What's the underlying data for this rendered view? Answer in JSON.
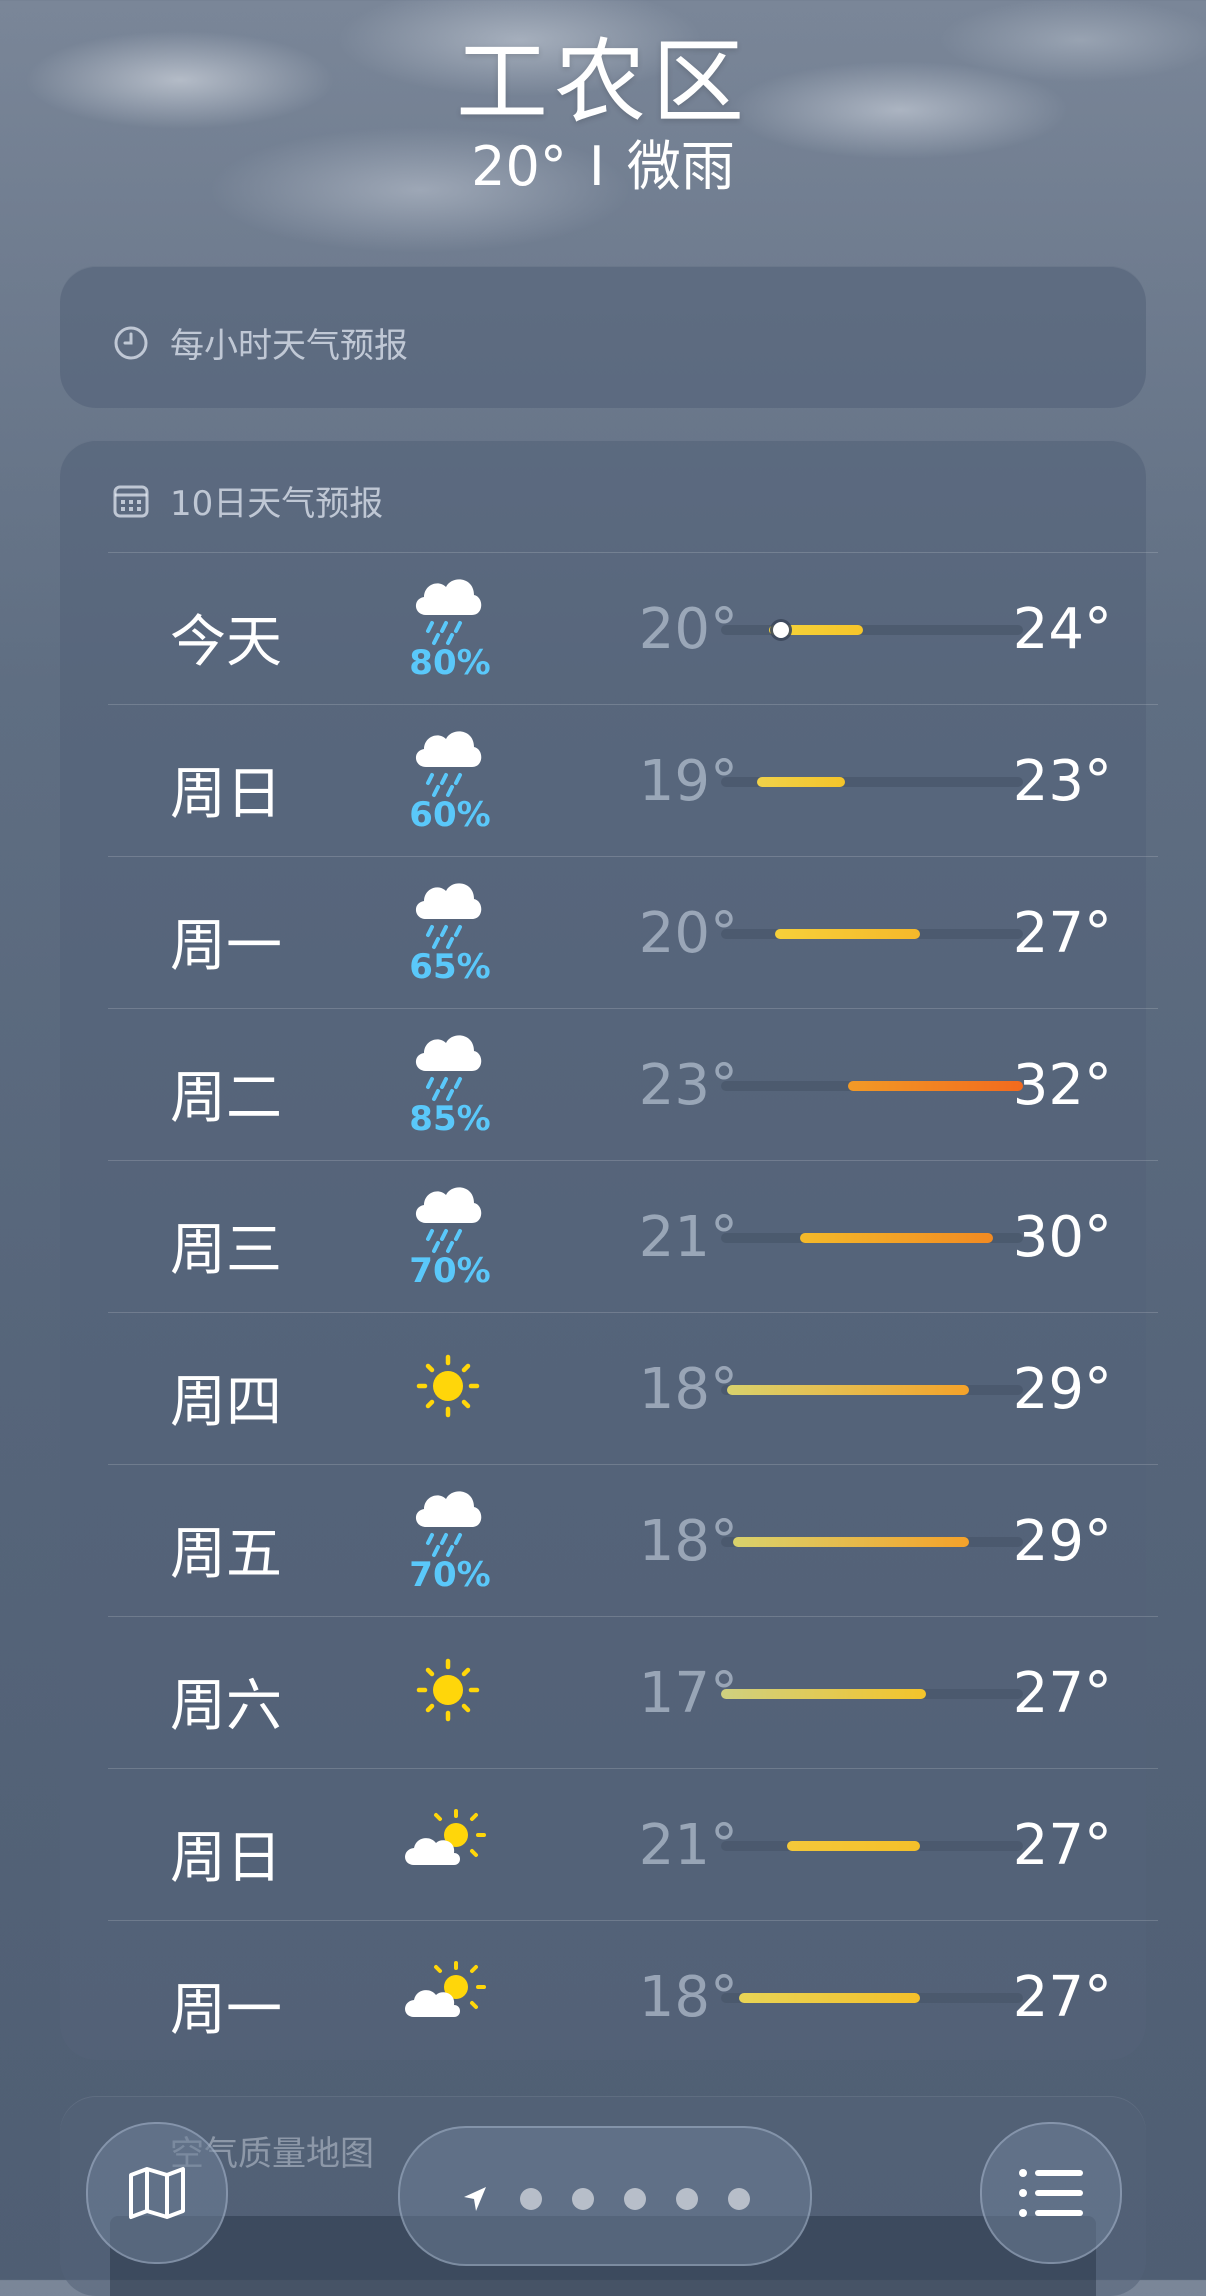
{
  "header": {
    "city": "工农区",
    "temperature": "20°",
    "separator": "I",
    "condition": "微雨"
  },
  "hourly_card": {
    "title": "每小时天气预报",
    "icon": "clock-icon"
  },
  "daily_card": {
    "title": "10日天气预报",
    "icon": "calendar-icon",
    "current_temp_marker": 20,
    "days": [
      {
        "day": "今天",
        "icon": "cloud-rain-icon",
        "precip": "80%",
        "low": "20°",
        "high": "24°",
        "low_value": 20,
        "high_value": 24,
        "bar_from": 0.16,
        "bar_to": 0.47,
        "colors": [
          "#f6d43a",
          "#f6c52a"
        ],
        "show_dot": true,
        "dot_at": 0.2
      },
      {
        "day": "周日",
        "icon": "cloud-rain-icon",
        "precip": "60%",
        "low": "19°",
        "high": "23°",
        "low_value": 19,
        "high_value": 23,
        "bar_from": 0.12,
        "bar_to": 0.41,
        "colors": [
          "#f1d24a",
          "#f4c42a"
        ],
        "show_dot": false
      },
      {
        "day": "周一",
        "icon": "cloud-rain-icon",
        "precip": "65%",
        "low": "20°",
        "high": "27°",
        "low_value": 20,
        "high_value": 27,
        "bar_from": 0.18,
        "bar_to": 0.66,
        "colors": [
          "#f6d03a",
          "#f5b82a"
        ],
        "show_dot": false
      },
      {
        "day": "周二",
        "icon": "cloud-rain-icon",
        "precip": "85%",
        "low": "23°",
        "high": "32°",
        "low_value": 23,
        "high_value": 32,
        "bar_from": 0.42,
        "bar_to": 1.0,
        "colors": [
          "#f29a26",
          "#f26a1e"
        ],
        "show_dot": false
      },
      {
        "day": "周三",
        "icon": "cloud-rain-icon",
        "precip": "70%",
        "low": "21°",
        "high": "30°",
        "low_value": 21,
        "high_value": 30,
        "bar_from": 0.26,
        "bar_to": 0.9,
        "colors": [
          "#f4ba2a",
          "#f28a22"
        ],
        "show_dot": false
      },
      {
        "day": "周四",
        "icon": "sun-icon",
        "precip": "",
        "low": "18°",
        "high": "29°",
        "low_value": 18,
        "high_value": 29,
        "bar_from": 0.02,
        "bar_to": 0.82,
        "colors": [
          "#d9d26c",
          "#f4a22a"
        ],
        "show_dot": false
      },
      {
        "day": "周五",
        "icon": "cloud-rain-icon",
        "precip": "70%",
        "low": "18°",
        "high": "29°",
        "low_value": 18,
        "high_value": 29,
        "bar_from": 0.04,
        "bar_to": 0.82,
        "colors": [
          "#d9d26c",
          "#f4a22a"
        ],
        "show_dot": false
      },
      {
        "day": "周六",
        "icon": "sun-icon",
        "precip": "",
        "low": "17°",
        "high": "27°",
        "low_value": 17,
        "high_value": 27,
        "bar_from": 0.0,
        "bar_to": 0.68,
        "colors": [
          "#cfd080",
          "#f4c42a"
        ],
        "show_dot": false
      },
      {
        "day": "周日",
        "icon": "partly-cloudy-icon",
        "precip": "",
        "low": "21°",
        "high": "27°",
        "low_value": 21,
        "high_value": 27,
        "bar_from": 0.22,
        "bar_to": 0.66,
        "colors": [
          "#f4c83a",
          "#f4c02a"
        ],
        "show_dot": false
      },
      {
        "day": "周一",
        "icon": "partly-cloudy-icon",
        "precip": "",
        "low": "18°",
        "high": "27°",
        "low_value": 18,
        "high_value": 27,
        "bar_from": 0.06,
        "bar_to": 0.66,
        "colors": [
          "#e9d556",
          "#f4c02a"
        ],
        "show_dot": false
      }
    ]
  },
  "aqi_card": {
    "title": "空气质量地图"
  },
  "bottom_bar": {
    "map_button": "map-icon",
    "list_button": "list-icon",
    "page_count": 5,
    "location_icon": "location-arrow-icon"
  }
}
